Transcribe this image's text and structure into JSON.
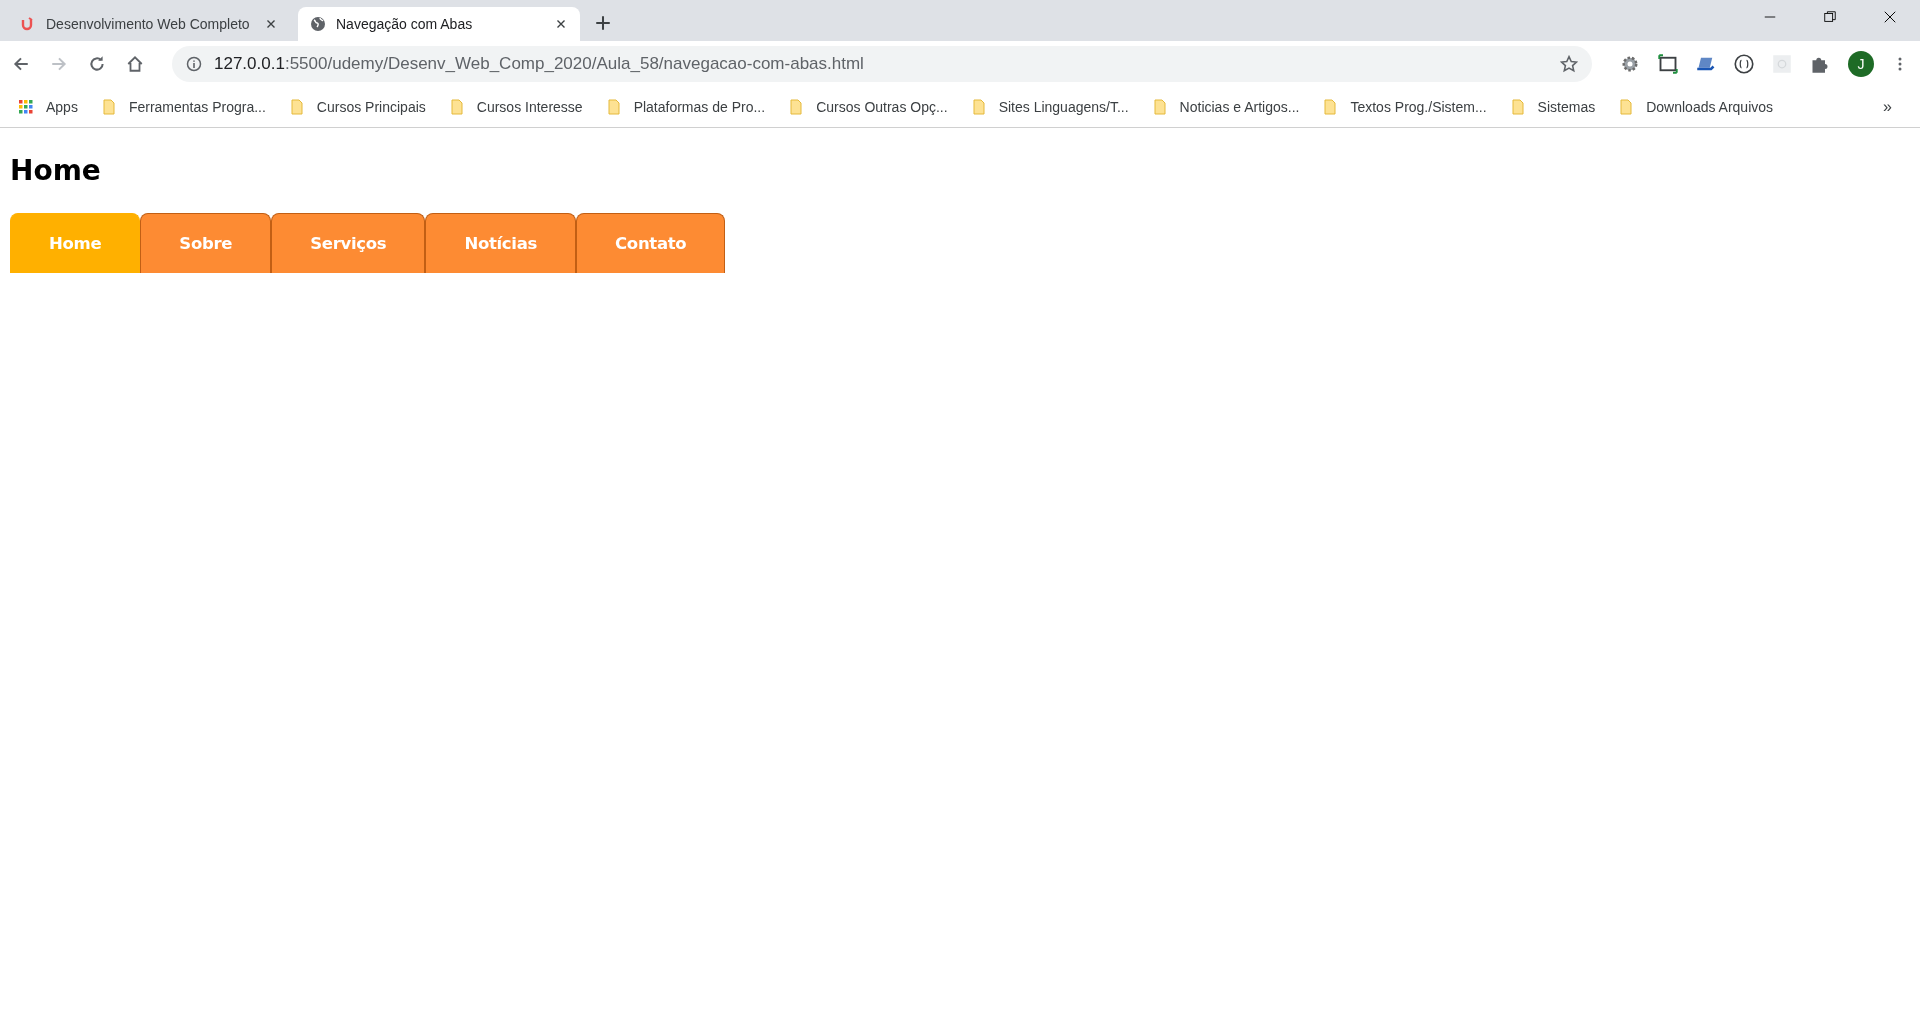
{
  "browser_tabs": [
    {
      "title": "Desenvolvimento Web Completo",
      "kind": "udemy",
      "selected": false
    },
    {
      "title": "Navegação com Abas",
      "kind": "web",
      "selected": true
    }
  ],
  "address_bar": {
    "host": "127.0.0.1",
    "path": ":5500/udemy/Desenv_Web_Comp_2020/Aula_58/navegacao-com-abas.html"
  },
  "bookmarks": [
    {
      "label": "Apps",
      "kind": "apps"
    },
    {
      "label": "Ferramentas Progra...",
      "kind": "folder"
    },
    {
      "label": "Cursos Principais",
      "kind": "folder"
    },
    {
      "label": "Cursos Interesse",
      "kind": "folder"
    },
    {
      "label": "Plataformas de Pro...",
      "kind": "folder"
    },
    {
      "label": "Cursos Outras Opç...",
      "kind": "folder"
    },
    {
      "label": "Sites Linguagens/T...",
      "kind": "folder"
    },
    {
      "label": "Noticias e Artigos...",
      "kind": "folder"
    },
    {
      "label": "Textos Prog./Sistem...",
      "kind": "folder"
    },
    {
      "label": "Sistemas",
      "kind": "folder"
    },
    {
      "label": "Downloads Arquivos",
      "kind": "folder"
    }
  ],
  "bookmarks_overflow": "»",
  "profile_initial": "J",
  "page": {
    "heading": "Home",
    "nav_tabs": [
      {
        "label": "Home",
        "selected": true
      },
      {
        "label": "Sobre",
        "selected": false
      },
      {
        "label": "Serviços",
        "selected": false
      },
      {
        "label": "Notícias",
        "selected": false
      },
      {
        "label": "Contato",
        "selected": false
      }
    ]
  }
}
